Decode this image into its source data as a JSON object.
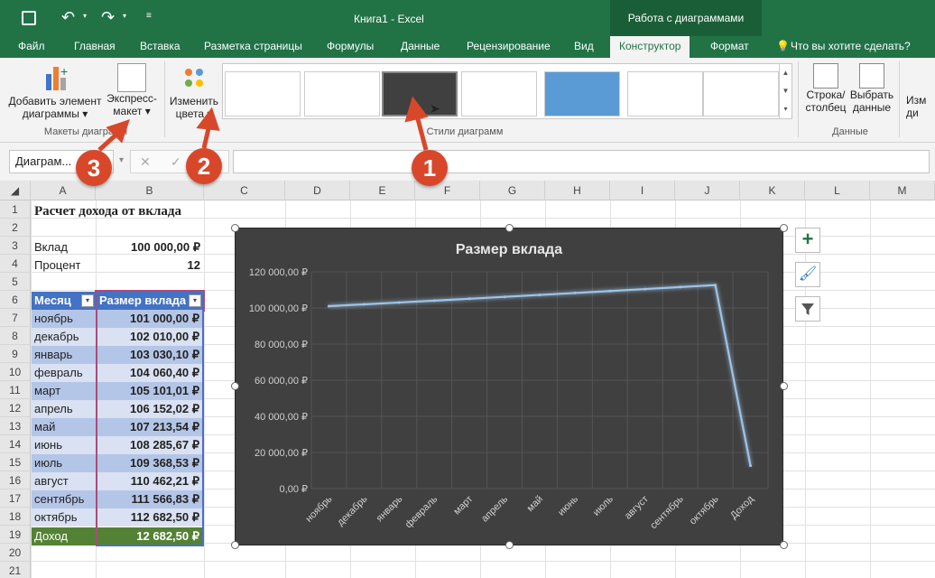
{
  "titlebar": {
    "doc_title": "Книга1 - Excel",
    "context_tab": "Работа с диаграммами"
  },
  "tabs": [
    "Файл",
    "Главная",
    "Вставка",
    "Разметка страницы",
    "Формулы",
    "Данные",
    "Рецензирование",
    "Вид",
    "Конструктор",
    "Формат"
  ],
  "tell_me": "Что вы хотите сделать?",
  "ribbon": {
    "add_element": [
      "Добавить элемент",
      "диаграммы"
    ],
    "express_layout": [
      "Экспресс-",
      "макет"
    ],
    "group_layouts": "Макеты диаграмм",
    "change_colors": [
      "Изменить",
      "цвета"
    ],
    "group_styles": "Стили диаграмм",
    "row_col": [
      "Строка/",
      "столбец"
    ],
    "select_data": [
      "Выбрать",
      "данные"
    ],
    "group_data": "Данные",
    "cut_label": [
      "Изм",
      "ди"
    ]
  },
  "namebox": "Диаграм...",
  "columns": [
    "A",
    "B",
    "C",
    "D",
    "E",
    "F",
    "G",
    "H",
    "I",
    "J",
    "K",
    "L",
    "M"
  ],
  "sheet": {
    "title": "Расчет дохода от вклада",
    "deposit_label": "Вклад",
    "deposit_value": "100 000,00 ₽",
    "percent_label": "Процент",
    "percent_value": "12",
    "hdr_month": "Месяц",
    "hdr_size": "Размер вклада",
    "rows": [
      [
        "ноябрь",
        "101 000,00 ₽"
      ],
      [
        "декабрь",
        "102 010,00 ₽"
      ],
      [
        "январь",
        "103 030,10 ₽"
      ],
      [
        "февраль",
        "104 060,40 ₽"
      ],
      [
        "март",
        "105 101,01 ₽"
      ],
      [
        "апрель",
        "106 152,02 ₽"
      ],
      [
        "май",
        "107 213,54 ₽"
      ],
      [
        "июнь",
        "108 285,67 ₽"
      ],
      [
        "июль",
        "109 368,53 ₽"
      ],
      [
        "август",
        "110 462,21 ₽"
      ],
      [
        "сентябрь",
        "111 566,83 ₽"
      ],
      [
        "октябрь",
        "112 682,50 ₽"
      ]
    ],
    "income_label": "Доход",
    "income_value": "12 682,50 ₽"
  },
  "callouts": [
    "1",
    "2",
    "3"
  ],
  "colors": {
    "excel_green": "#217346",
    "table_header": "#4472c4",
    "total_row": "#548235",
    "line": "#9dc3e6"
  },
  "chart_data": {
    "type": "line",
    "title": "Размер вклада",
    "categories": [
      "ноябрь",
      "декабрь",
      "январь",
      "февраль",
      "март",
      "апрель",
      "май",
      "июнь",
      "июль",
      "август",
      "сентябрь",
      "октябрь",
      "Доход"
    ],
    "values": [
      101000,
      102010,
      103030.1,
      104060.4,
      105101.01,
      106152.02,
      107213.54,
      108285.67,
      109368.53,
      110462.21,
      111566.83,
      112682.5,
      12682.5
    ],
    "ylim": [
      0,
      120000
    ],
    "yticks": [
      "0,00 ₽",
      "20 000,00 ₽",
      "40 000,00 ₽",
      "60 000,00 ₽",
      "80 000,00 ₽",
      "100 000,00 ₽",
      "120 000,00 ₽"
    ],
    "grid": true
  }
}
